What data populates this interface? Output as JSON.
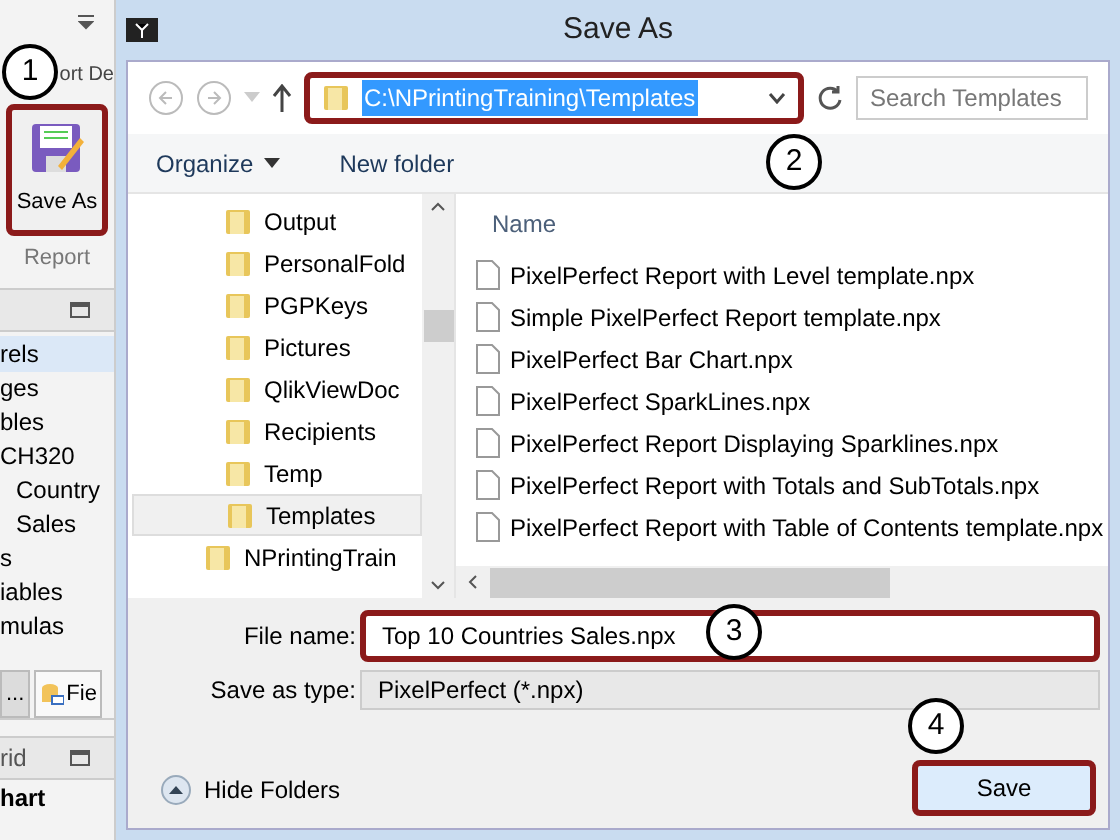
{
  "app": {
    "ribbon_tab": "ort De",
    "ribbon_button": "Save As",
    "ribbon_group": "Report",
    "panel_items": [
      {
        "label": "rels",
        "selected": true
      },
      {
        "label": "ges",
        "selected": false
      },
      {
        "label": "bles",
        "selected": false
      },
      {
        "label": "CH320",
        "selected": false,
        "children": [
          {
            "label": "Country",
            "selected": false
          },
          {
            "label": "Sales",
            "selected": false
          }
        ]
      },
      {
        "label": "s",
        "selected": false
      },
      {
        "label": "iables",
        "selected": false
      },
      {
        "label": "mulas",
        "selected": false
      }
    ],
    "tabs": [
      {
        "label": "...",
        "selected": true
      },
      {
        "label": "Fie",
        "selected": false
      }
    ],
    "lower_panel_title": "rid",
    "lower_panel_item": "hart"
  },
  "dialog": {
    "title": "Save As",
    "address": "C:\\NPrintingTraining\\Templates",
    "search_placeholder": "Search Templates",
    "toolbar": [
      "Organize",
      "New folder"
    ],
    "tree": [
      {
        "label": "Output",
        "selected": false,
        "kind": "subfolder"
      },
      {
        "label": "PersonalFold",
        "selected": false,
        "kind": "subfolder"
      },
      {
        "label": "PGPKeys",
        "selected": false,
        "kind": "subfolder"
      },
      {
        "label": "Pictures",
        "selected": false,
        "kind": "subfolder"
      },
      {
        "label": "QlikViewDoc",
        "selected": false,
        "kind": "subfolder"
      },
      {
        "label": "Recipients",
        "selected": false,
        "kind": "subfolder"
      },
      {
        "label": "Temp",
        "selected": false,
        "kind": "subfolder"
      },
      {
        "label": "Templates",
        "selected": true,
        "kind": "subfolder"
      },
      {
        "label": "NPrintingTrain",
        "selected": false,
        "kind": "folder"
      }
    ],
    "column": "Name",
    "files": [
      "PixelPerfect Report with Level template.npx",
      "Simple PixelPerfect Report template.npx",
      "PixelPerfect Bar Chart.npx",
      "PixelPerfect SparkLines.npx",
      "PixelPerfect Report Displaying Sparklines.npx",
      "PixelPerfect Report with Totals and SubTotals.npx",
      "PixelPerfect Report with Table of Contents template.npx"
    ],
    "file_name_label": "File name:",
    "file_name": "Top 10 Countries Sales.npx",
    "save_type_label": "Save as type:",
    "save_type": "PixelPerfect (*.npx)",
    "hide_folders": "Hide Folders",
    "save_button": "Save"
  },
  "callouts": [
    "1",
    "2",
    "3",
    "4"
  ]
}
